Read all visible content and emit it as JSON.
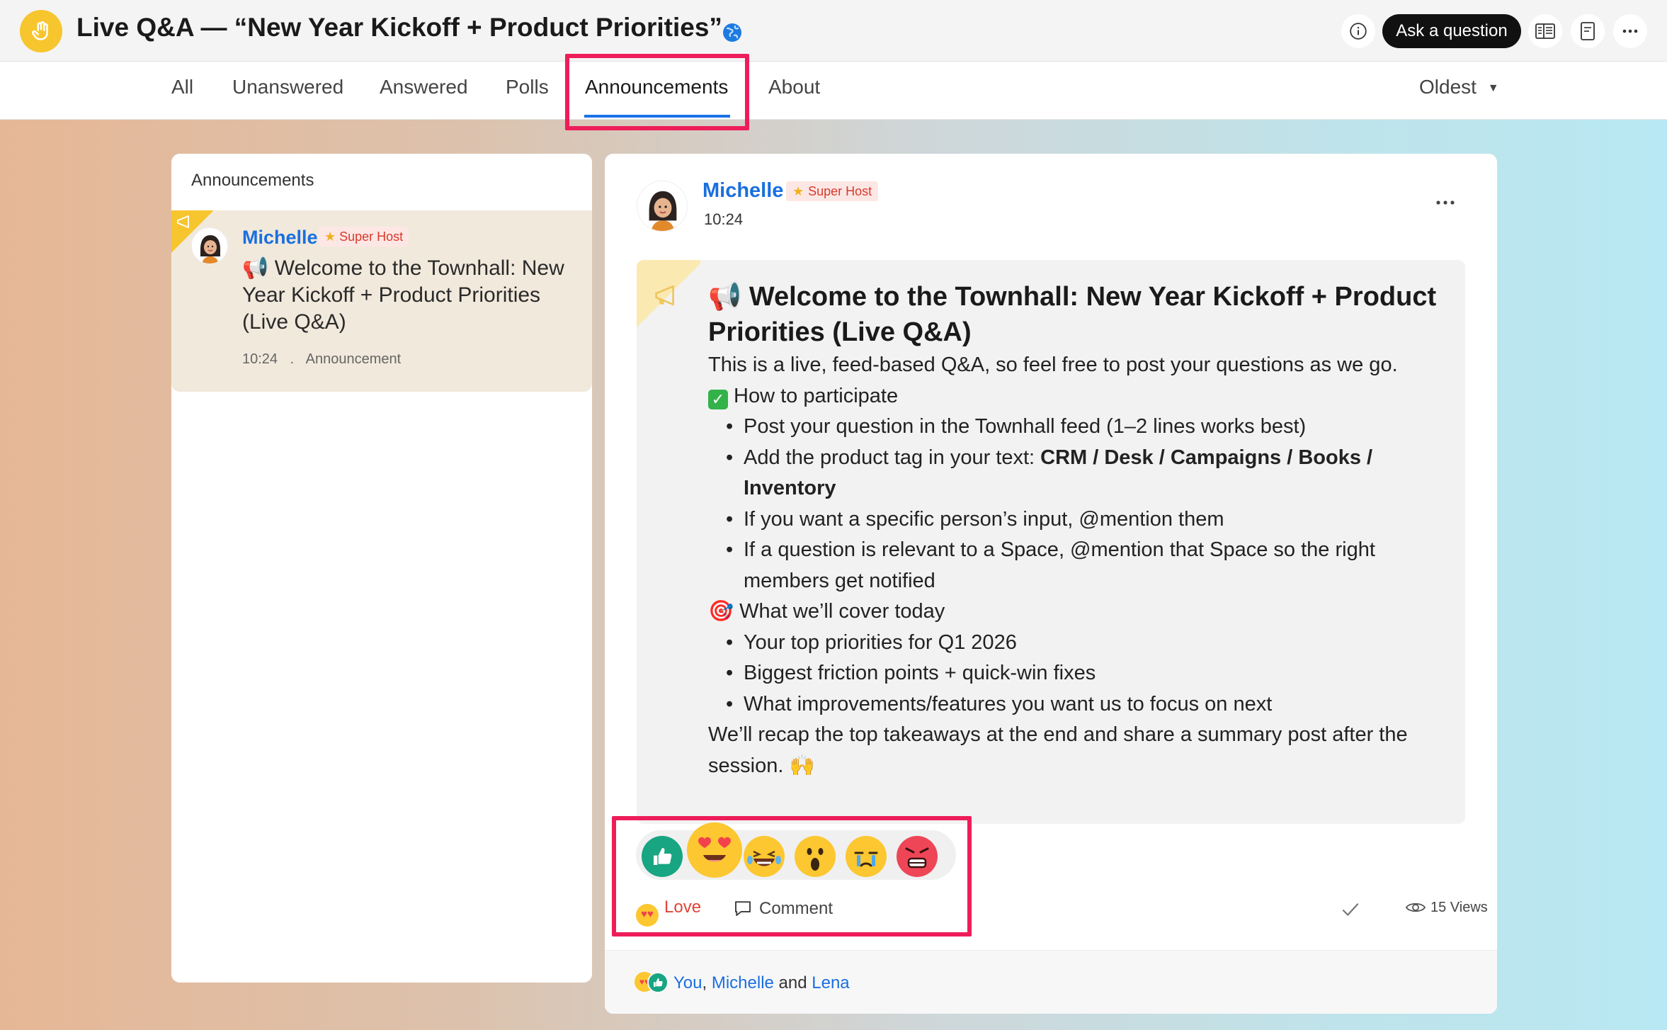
{
  "header": {
    "title": "Live Q&A — “New Year Kickoff + Product Priorities”",
    "ask_button": "Ask a question",
    "icons": [
      "hand-icon",
      "globe-icon",
      "info-icon",
      "reader-icon",
      "notes-icon",
      "more-icon"
    ]
  },
  "tabs": [
    {
      "label": "All"
    },
    {
      "label": "Unanswered"
    },
    {
      "label": "Answered"
    },
    {
      "label": "Polls"
    },
    {
      "label": "Announcements",
      "active": true
    },
    {
      "label": "About"
    }
  ],
  "sort": {
    "label": "Oldest"
  },
  "sidebar": {
    "title": "Announcements",
    "item": {
      "author": "Michelle",
      "badge": "Super Host",
      "text": "📢 Welcome to the Townhall: New Year Kickoff + Product Priorities (Live Q&A)",
      "time": "10:24",
      "sep": ".",
      "type": "Announcement"
    }
  },
  "post": {
    "author": "Michelle",
    "badge": "Super Host",
    "time": "10:24",
    "title": "📢 Welcome to the Townhall: New Year Kickoff + Product Priorities (Live Q&A)",
    "intro": "This is a live, feed-based Q&A, so feel free to post your questions as we go.",
    "section1": "How to participate",
    "bullets1": [
      "Post your question in the Townhall feed (1–2 lines works best)",
      "Add the product tag in your text: ",
      "If you want a specific person’s input, @mention them",
      "If a question is relevant to a Space, @mention that Space so the right members get notified"
    ],
    "product_tags": "CRM / Desk / Campaigns / Books / Inventory",
    "section2": "🎯 What we’ll cover today",
    "bullets2": [
      "Your top priorities for Q1 2026",
      "Biggest friction points + quick-win fixes",
      "What improvements/features you want us to focus on next"
    ],
    "closing": "We’ll recap the top takeaways at the end and share a summary post after the session. 🙌",
    "reactions": [
      "like",
      "love",
      "haha",
      "wow",
      "sad",
      "angry"
    ],
    "selected_reaction": "Love",
    "comment_label": "Comment",
    "views": "15 Views",
    "reactors": {
      "you": "You",
      "comma": ",",
      "name1": "Michelle",
      "and": "and",
      "name2": "Lena"
    }
  },
  "colors": {
    "accent": "#1a73e8",
    "highlight": "#ee1d5a",
    "link": "#1a6fdf",
    "love": "#e0443a"
  }
}
